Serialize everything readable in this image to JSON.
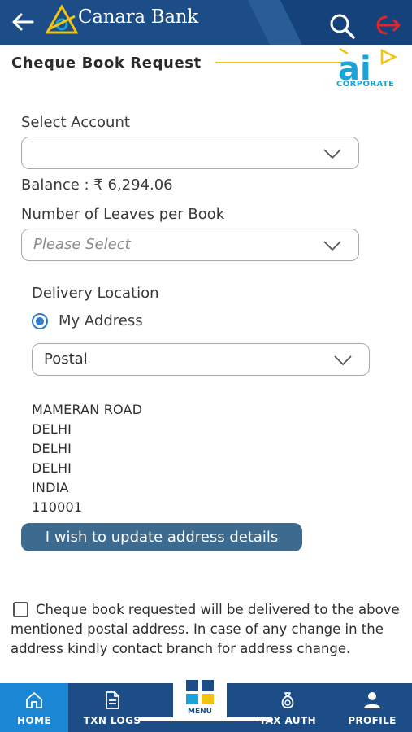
{
  "header": {
    "brand": "Canara Bank",
    "colors": {
      "primary": "#1c4d86",
      "accent_yellow": "#f1c40f",
      "logout_red": "#e0262b"
    }
  },
  "page": {
    "title": "Cheque Book Request",
    "badge_text": "ai",
    "badge_sub": "CORPORATE"
  },
  "form": {
    "select_account_label": "Select Account",
    "select_account_value": "",
    "balance_text": "Balance : ₹ 6,294.06",
    "leaves_label": "Number of Leaves per Book",
    "leaves_placeholder": "Please Select",
    "delivery_label": "Delivery Location",
    "radio_label": "My Address",
    "delivery_mode_value": "Postal",
    "address_lines": [
      "MAMERAN ROAD",
      "DELHI",
      "DELHI",
      "DELHI",
      "INDIA",
      "110001"
    ],
    "update_button": "I wish to update address details",
    "notice": "Cheque book requested will be delivered to the above mentioned postal address. In case of any change in the address kindly contact branch for address change."
  },
  "nav": {
    "home": "HOME",
    "txn_logs": "TXN LOGS",
    "menu": "MENU",
    "tax_auth": "TAX AUTH",
    "profile": "PROFILE"
  }
}
